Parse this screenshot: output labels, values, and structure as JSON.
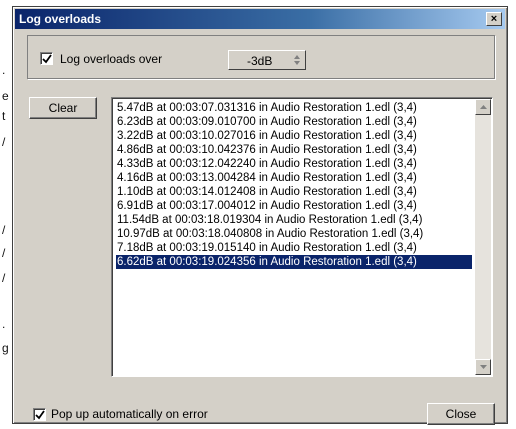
{
  "background_fragments": [
    ".",
    "e",
    "t",
    "/",
    "/",
    "/",
    "/",
    ".",
    "g"
  ],
  "dialog": {
    "title": "Log overloads",
    "close_glyph": "×",
    "log_overloads": {
      "checked": true,
      "label": "Log overloads over",
      "threshold": "-3dB"
    },
    "clear_label": "Clear",
    "log_entries": [
      "5.47dB at 00:03:07.031316 in Audio Restoration 1.edl (3,4)",
      "6.23dB at 00:03:09.010700 in Audio Restoration 1.edl (3,4)",
      "3.22dB at 00:03:10.027016 in Audio Restoration 1.edl (3,4)",
      "4.86dB at 00:03:10.042376 in Audio Restoration 1.edl (3,4)",
      "4.33dB at 00:03:12.042240 in Audio Restoration 1.edl (3,4)",
      "4.16dB at 00:03:13.004284 in Audio Restoration 1.edl (3,4)",
      "1.10dB at 00:03:14.012408 in Audio Restoration 1.edl (3,4)",
      "6.91dB at 00:03:17.004012 in Audio Restoration 1.edl (3,4)",
      "11.54dB at 00:03:18.019304 in Audio Restoration 1.edl (3,4)",
      "10.97dB at 00:03:18.040808 in Audio Restoration 1.edl (3,4)",
      "7.18dB at 00:03:19.015140 in Audio Restoration 1.edl (3,4)",
      "6.62dB at 00:03:19.024356 in Audio Restoration 1.edl (3,4)"
    ],
    "selected_index": 11,
    "popup_on_error": {
      "checked": true,
      "label": "Pop up automatically on error"
    },
    "close_label": "Close"
  },
  "colors": {
    "titlebar_start": "#0a246a",
    "titlebar_end": "#a6caf0",
    "face": "#d4d0c8",
    "selection": "#0a246a"
  }
}
